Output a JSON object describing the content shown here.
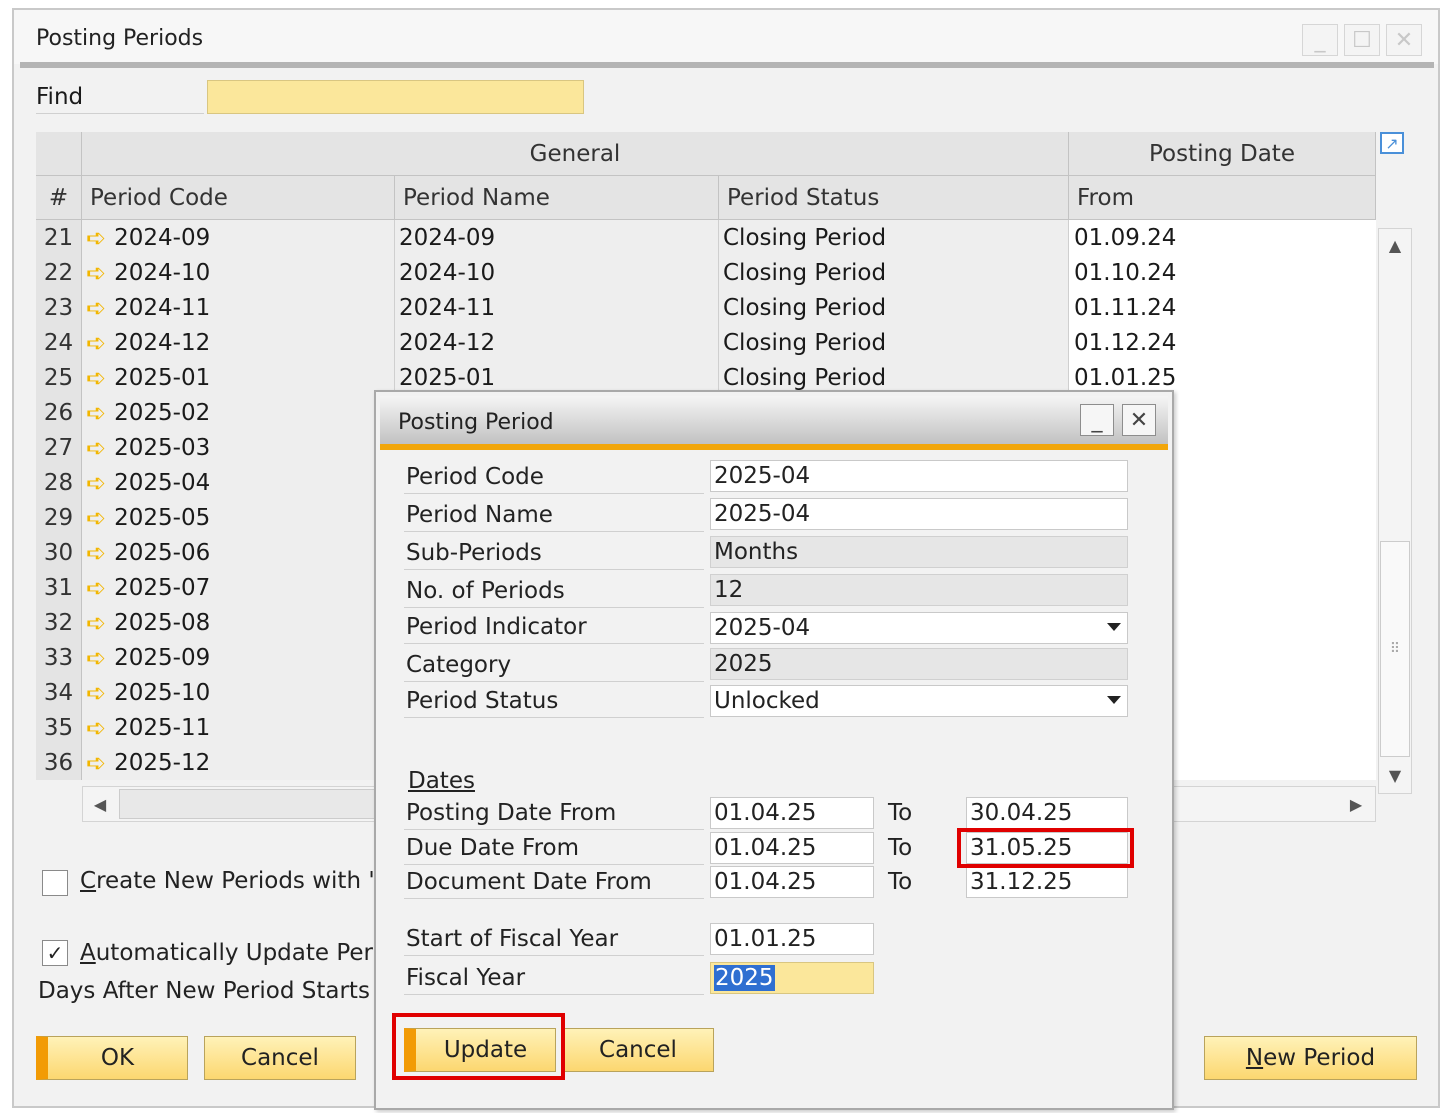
{
  "main": {
    "title": "Posting Periods",
    "find_label": "Find",
    "find_value": "",
    "headers": {
      "num": "#",
      "group_general": "General",
      "group_posting_date": "Posting Date",
      "period_code": "Period Code",
      "period_name": "Period Name",
      "period_status": "Period Status",
      "from": "From"
    },
    "rows": [
      {
        "num": "21",
        "code": "2024-09",
        "name": "2024-09",
        "status": "Closing Period",
        "from": "01.09.24"
      },
      {
        "num": "22",
        "code": "2024-10",
        "name": "2024-10",
        "status": "Closing Period",
        "from": "01.10.24"
      },
      {
        "num": "23",
        "code": "2024-11",
        "name": "2024-11",
        "status": "Closing Period",
        "from": "01.11.24"
      },
      {
        "num": "24",
        "code": "2024-12",
        "name": "2024-12",
        "status": "Closing Period",
        "from": "01.12.24"
      },
      {
        "num": "25",
        "code": "2025-01",
        "name": "2025-01",
        "status": "Closing Period",
        "from": "01.01.25"
      },
      {
        "num": "26",
        "code": "2025-02",
        "name": "",
        "status": "",
        "from": ""
      },
      {
        "num": "27",
        "code": "2025-03",
        "name": "",
        "status": "",
        "from": ""
      },
      {
        "num": "28",
        "code": "2025-04",
        "name": "",
        "status": "",
        "from": ""
      },
      {
        "num": "29",
        "code": "2025-05",
        "name": "",
        "status": "",
        "from": ""
      },
      {
        "num": "30",
        "code": "2025-06",
        "name": "",
        "status": "",
        "from": ""
      },
      {
        "num": "31",
        "code": "2025-07",
        "name": "",
        "status": "",
        "from": ""
      },
      {
        "num": "32",
        "code": "2025-08",
        "name": "",
        "status": "",
        "from": ""
      },
      {
        "num": "33",
        "code": "2025-09",
        "name": "",
        "status": "",
        "from": ""
      },
      {
        "num": "34",
        "code": "2025-10",
        "name": "",
        "status": "",
        "from": ""
      },
      {
        "num": "35",
        "code": "2025-11",
        "name": "",
        "status": "",
        "from": ""
      },
      {
        "num": "36",
        "code": "2025-12",
        "name": "",
        "status": "",
        "from": ""
      }
    ],
    "create_new_periods_label_prefix": "C",
    "create_new_periods_label_rest": "reate New Periods with 'D",
    "create_new_periods_checked": false,
    "auto_update_label_prefix": "A",
    "auto_update_label_rest": "utomatically Update Perioc",
    "auto_update_checked": true,
    "days_after_label": "Days After New Period Starts",
    "ok_label": "OK",
    "cancel_label": "Cancel",
    "new_period_label_prefix": "N",
    "new_period_label_rest": "ew Period"
  },
  "dialog": {
    "title": "Posting Period",
    "fields": {
      "period_code": {
        "label": "Period Code",
        "value": "2025-04"
      },
      "period_name": {
        "label": "Period Name",
        "value": "2025-04"
      },
      "sub_periods": {
        "label": "Sub-Periods",
        "value": "Months"
      },
      "no_of_periods": {
        "label": "No. of Periods",
        "value": "12"
      },
      "period_indicator": {
        "label": "Period Indicator",
        "value": "2025-04"
      },
      "category": {
        "label": "Category",
        "value": "2025"
      },
      "period_status": {
        "label": "Period Status",
        "value": "Unlocked"
      }
    },
    "dates_section_label": "Dates",
    "to_label": "To",
    "dates": {
      "posting": {
        "label": "Posting Date From",
        "from": "01.04.25",
        "to": "30.04.25"
      },
      "due": {
        "label": "Due Date From",
        "from": "01.04.25",
        "to": "31.05.25"
      },
      "document": {
        "label": "Document Date From",
        "from": "01.04.25",
        "to": "31.12.25"
      }
    },
    "start_fiscal_year": {
      "label": "Start of Fiscal Year",
      "value": "01.01.25"
    },
    "fiscal_year": {
      "label": "Fiscal Year",
      "value": "2025"
    },
    "update_label": "Update",
    "cancel_label": "Cancel"
  },
  "colors": {
    "highlight_box": "#e00000",
    "input_yellow": "#fbe79b",
    "accent_orange": "#f29b05",
    "arrow": "#f2b600"
  },
  "icons": [
    "minimize-icon",
    "maximize-icon",
    "close-icon",
    "expand-arrow-icon",
    "row-arrow-icon",
    "scroll-up-icon",
    "scroll-down-icon",
    "scroll-left-icon",
    "scroll-right-icon",
    "dropdown-arrow-icon",
    "checkmark-icon"
  ]
}
